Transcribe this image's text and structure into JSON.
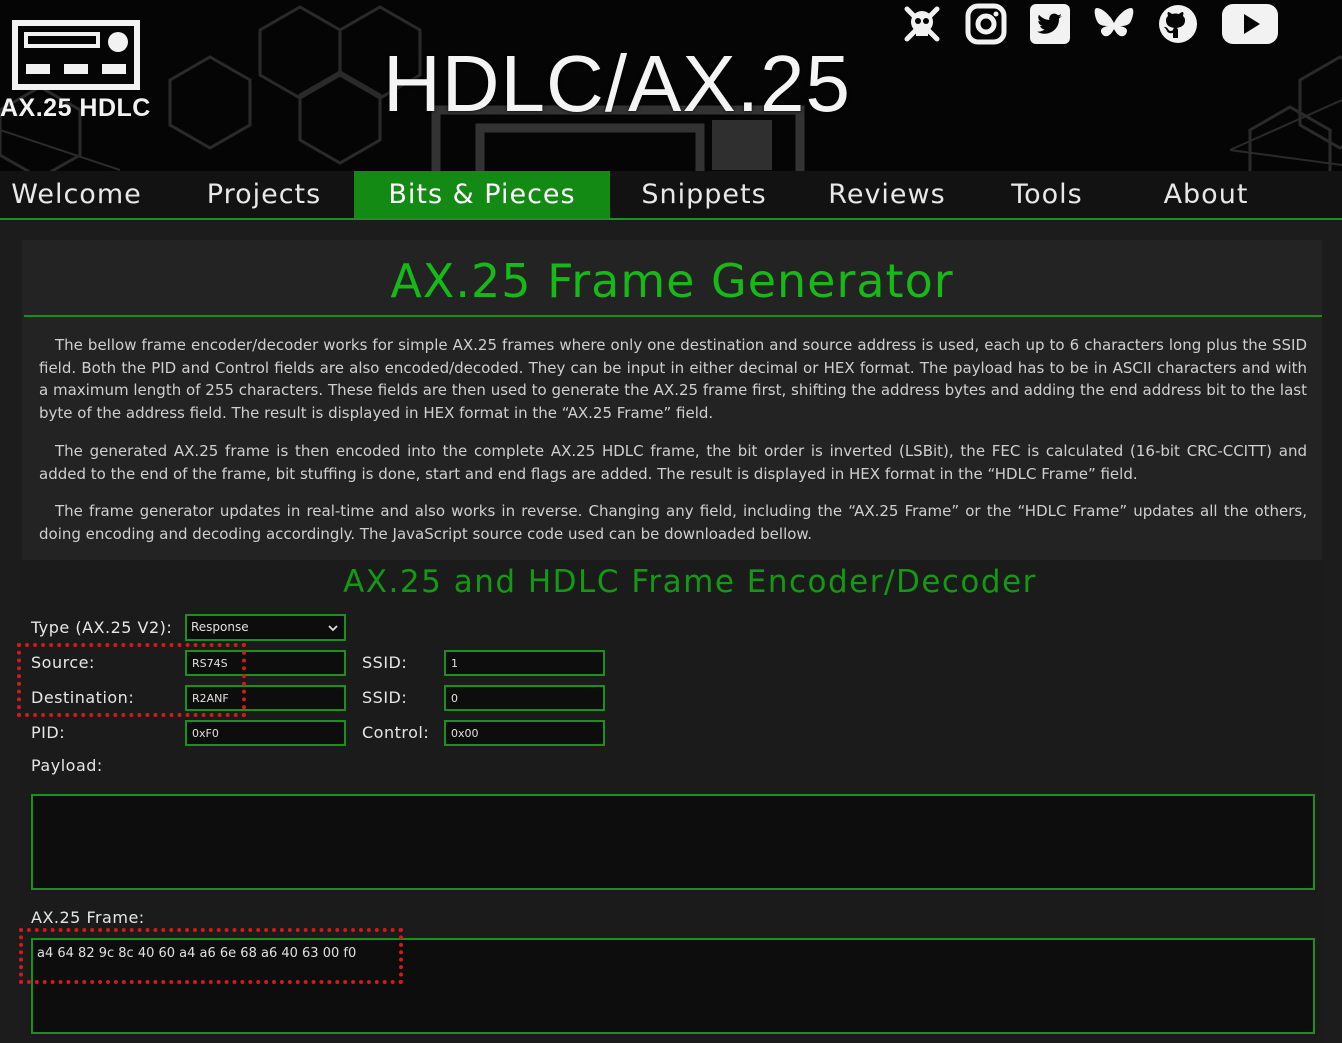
{
  "header": {
    "logo_label": "AX.25 HDLC",
    "site_title": "HDLC/AX.25",
    "social_icons": [
      "hackaday-icon",
      "instagram-icon",
      "twitter-icon",
      "bluesky-icon",
      "github-icon",
      "youtube-icon"
    ]
  },
  "nav": {
    "items": [
      {
        "label": "Welcome"
      },
      {
        "label": "Projects"
      },
      {
        "label": "Bits & Pieces",
        "active": true
      },
      {
        "label": "Snippets"
      },
      {
        "label": "Reviews"
      },
      {
        "label": "Tools"
      },
      {
        "label": "About"
      }
    ]
  },
  "article": {
    "title": "AX.25 Frame Generator",
    "paragraphs": [
      "The bellow frame encoder/decoder works for simple AX.25 frames where only one destination and source address is used, each up to 6 characters long plus the SSID field. Both the PID and Control fields are also encoded/decoded. They can be input in either decimal or HEX format. The payload has to be in ASCII characters and with a maximum length of 255 characters. These fields are then used to generate the AX.25 frame first, shifting the address bytes and adding the end address bit to the last byte of the address field. The result is displayed in HEX format in the “AX.25 Frame” field.",
      "The generated AX.25 frame is then encoded into the complete AX.25 HDLC frame, the bit order is inverted (LSBit), the FEC is calculated (16-bit CRC-CCITT) and added to the end of the frame, bit stuffing is done, start and end flags are added. The result is displayed in HEX format in the “HDLC Frame” field.",
      "The frame generator updates in real-time and also works in reverse. Changing any field, including the “AX.25 Frame” or the “HDLC Frame” updates all the others, doing encoding and decoding accordingly. The JavaScript source code used can be downloaded bellow."
    ]
  },
  "tool": {
    "title": "AX.25 and HDLC Frame Encoder/Decoder",
    "type_label": "Type (AX.25 V2):",
    "type_value": "Response",
    "source_label": "Source:",
    "source_value": "RS74S",
    "source_ssid_label": "SSID:",
    "source_ssid_value": "1",
    "destination_label": "Destination:",
    "destination_value": "R2ANF",
    "destination_ssid_label": "SSID:",
    "destination_ssid_value": "0",
    "pid_label": "PID:",
    "pid_value": "0xF0",
    "control_label": "Control:",
    "control_value": "0x00",
    "payload_label": "Payload:",
    "payload_value": "",
    "ax25_frame_label": "AX.25 Frame:",
    "ax25_frame_value": "a4 64 82 9c 8c 40 60 a4 a6 6e 68 a6 40 63 00 f0"
  },
  "colors": {
    "accent_green": "#17b917",
    "nav_active": "#138a13",
    "border_green": "#1d8f1d",
    "highlight_red": "#d11a1a"
  }
}
